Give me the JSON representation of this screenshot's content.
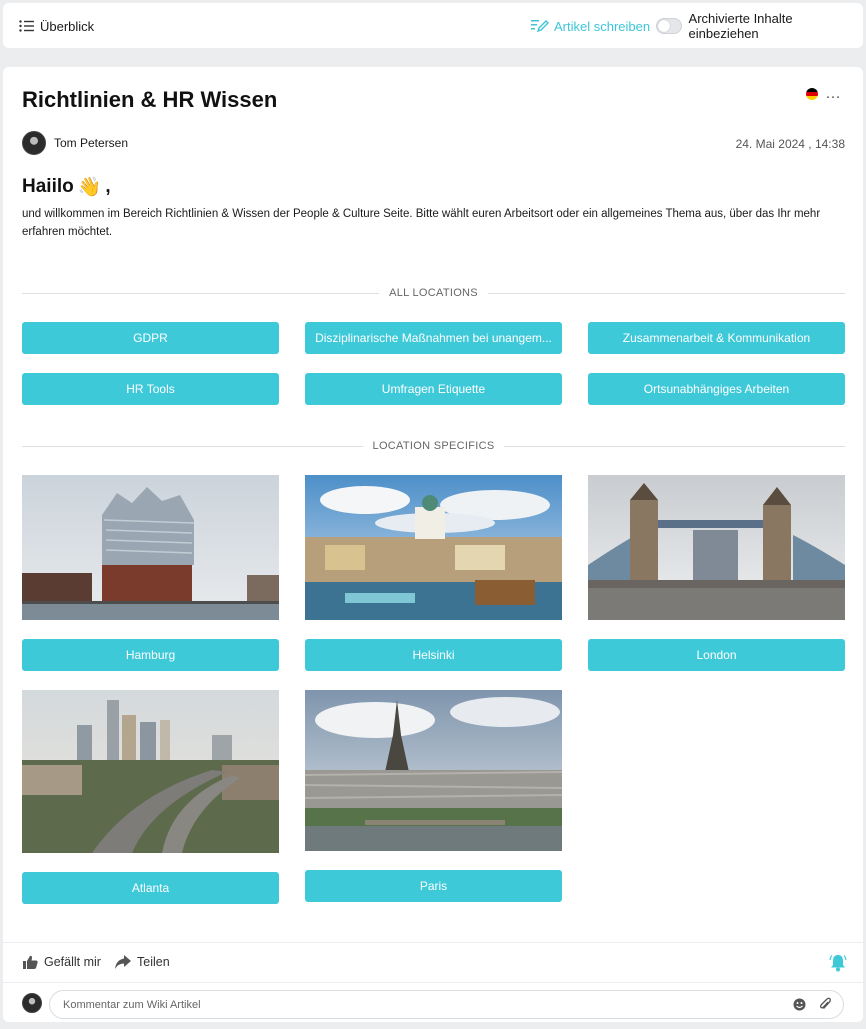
{
  "topbar": {
    "overview_label": "Überblick",
    "write_label": "Artikel schreiben",
    "archived_label": "Archivierte Inhalte einbeziehen"
  },
  "article": {
    "title": "Richtlinien & HR Wissen",
    "author": "Tom Petersen",
    "date": "24. Mai 2024 , 14:38",
    "greeting": "Haiilo",
    "greeting_emoji": "👋",
    "greeting_suffix": ",",
    "intro": "und willkommen im Bereich Richtlinien & Wissen der People & Culture Seite. Bitte wählt euren Arbeitsort oder ein allgemeines Thema aus, über das Ihr mehr erfahren möchtet."
  },
  "sections": {
    "all_locations": "ALL LOCATIONS",
    "location_specifics": "LOCATION SPECIFICS"
  },
  "topics": [
    "GDPR",
    "Disziplinarische Maßnahmen bei unangem...",
    "Zusammenarbeit & Kommunikation",
    "HR Tools",
    "Umfragen Etiquette",
    "Ortsunabhängiges Arbeiten"
  ],
  "locations": [
    "Hamburg",
    "Helsinki",
    "London",
    "Atlanta",
    "Paris"
  ],
  "footer": {
    "like_label": "Gefällt mir",
    "share_label": "Teilen",
    "comment_placeholder": "Kommentar zum Wiki Artikel"
  },
  "colors": {
    "accent": "#3ec9d9"
  },
  "icons": {
    "overview": "list-icon",
    "write": "pen-lines-icon",
    "like": "thumbs-up-icon",
    "share": "share-arrow-icon",
    "notifications": "bell-icon",
    "emoji": "smiley-icon",
    "attach": "paperclip-icon"
  }
}
